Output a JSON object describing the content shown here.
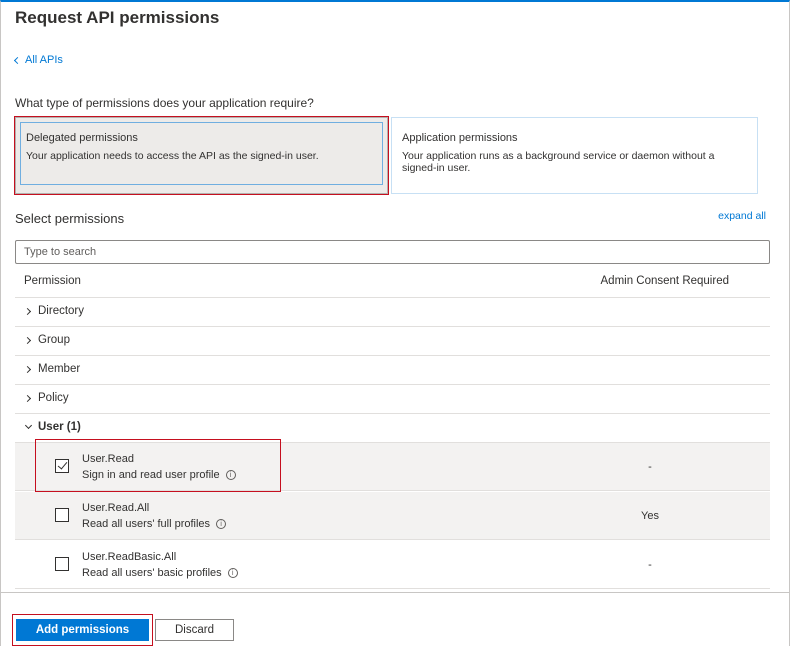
{
  "header": {
    "title": "Request API permissions"
  },
  "nav": {
    "back_label": "All APIs"
  },
  "question": "What type of permissions does your application require?",
  "permission_types": [
    {
      "title": "Delegated permissions",
      "description": "Your application needs to access the API as the signed-in user."
    },
    {
      "title": "Application permissions",
      "description": "Your application runs as a background service or daemon without a signed-in user."
    }
  ],
  "select": {
    "label": "Select permissions",
    "expand_all": "expand all",
    "search_placeholder": "Type to search"
  },
  "table": {
    "col_permission": "Permission",
    "col_admin": "Admin Consent Required"
  },
  "groups": [
    {
      "label": "Directory"
    },
    {
      "label": "Group"
    },
    {
      "label": "Member"
    },
    {
      "label": "Policy"
    },
    {
      "label": "User (1)"
    }
  ],
  "user_permissions": [
    {
      "name": "User.Read",
      "description": "Sign in and read user profile",
      "admin": "-",
      "checked": true
    },
    {
      "name": "User.Read.All",
      "description": "Read all users' full profiles",
      "admin": "Yes",
      "checked": false
    },
    {
      "name": "User.ReadBasic.All",
      "description": "Read all users' basic profiles",
      "admin": "-",
      "checked": false
    }
  ],
  "footer": {
    "add_label": "Add permissions",
    "discard_label": "Discard"
  },
  "colors": {
    "accent": "#0078d4",
    "highlight": "#c50f1f"
  }
}
